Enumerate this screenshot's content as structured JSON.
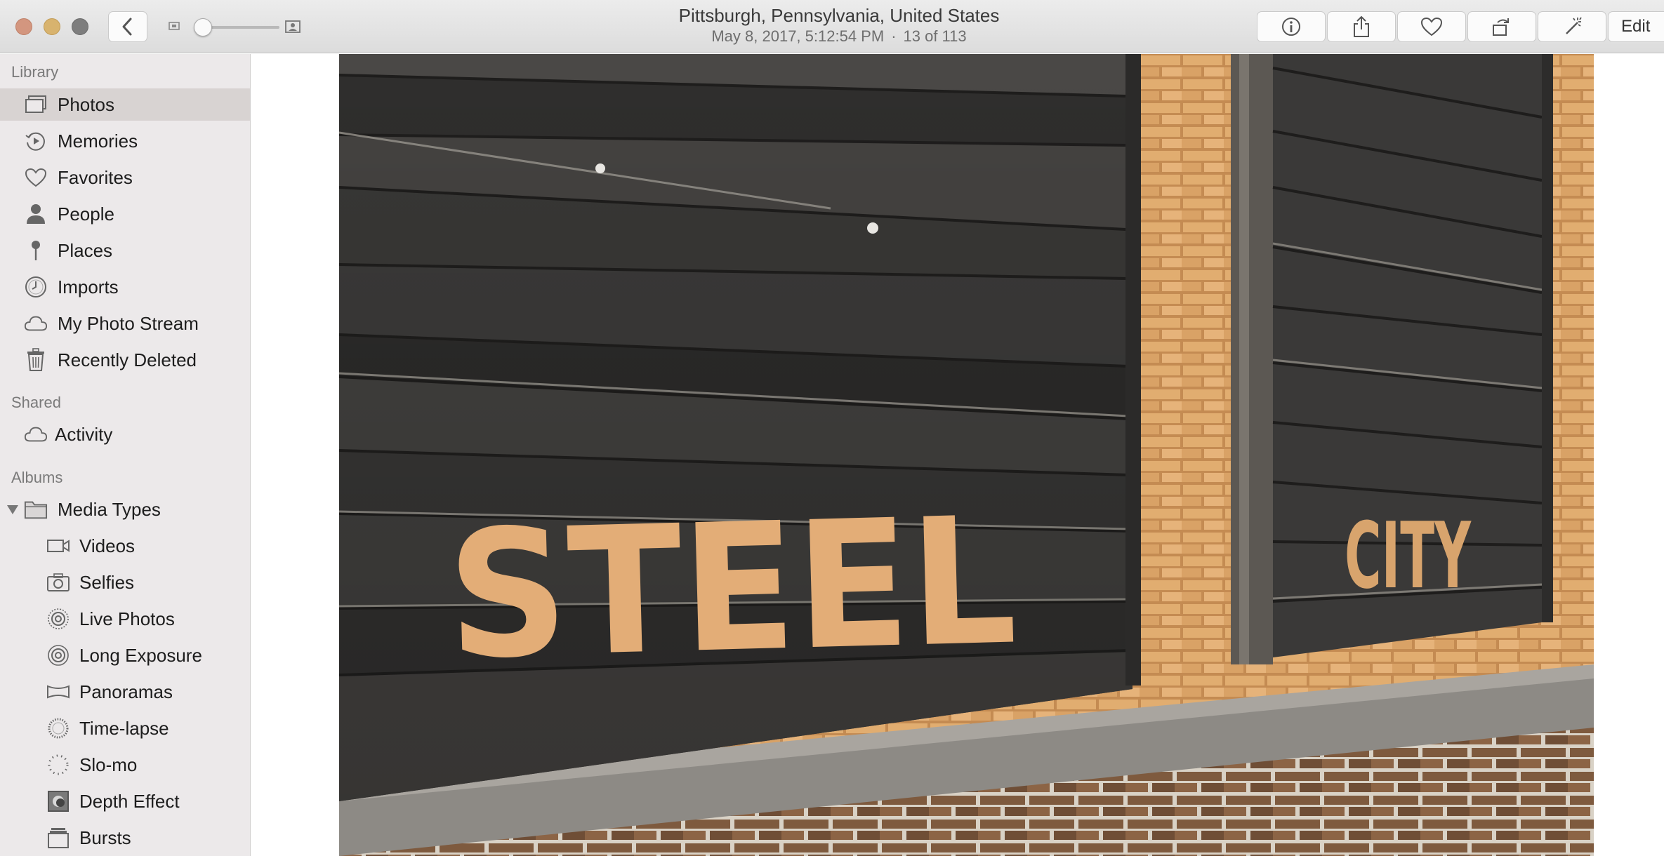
{
  "window": {
    "title": "Pittsburgh, Pennsylvania, United States",
    "date": "May 8, 2017, 5:12:54 PM",
    "separator": "·",
    "position": "13 of 113"
  },
  "toolbar": {
    "back_icon": "chevron-left-icon",
    "zoom_level": 0.05,
    "buttons": [
      {
        "icon": "info-icon"
      },
      {
        "icon": "share-icon"
      },
      {
        "icon": "heart-icon"
      },
      {
        "icon": "rotate-icon"
      },
      {
        "icon": "magic-wand-icon"
      }
    ],
    "edit_label": "Edit"
  },
  "sidebar": {
    "library_header": "Library",
    "library": [
      {
        "label": "Photos",
        "icon": "photos-icon",
        "selected": true
      },
      {
        "label": "Memories",
        "icon": "memories-icon"
      },
      {
        "label": "Favorites",
        "icon": "heart-icon"
      },
      {
        "label": "People",
        "icon": "person-icon"
      },
      {
        "label": "Places",
        "icon": "pin-icon"
      },
      {
        "label": "Imports",
        "icon": "clock-icon"
      },
      {
        "label": "My Photo Stream",
        "icon": "cloud-icon"
      },
      {
        "label": "Recently Deleted",
        "icon": "trash-icon"
      }
    ],
    "shared_header": "Shared",
    "shared": [
      {
        "label": "Activity",
        "icon": "cloud-icon"
      }
    ],
    "albums_header": "Albums",
    "albums": [
      {
        "label": "Media Types",
        "icon": "folder-icon",
        "expanded": true
      }
    ],
    "media_types": [
      {
        "label": "Videos",
        "icon": "video-icon"
      },
      {
        "label": "Selfies",
        "icon": "camera-icon"
      },
      {
        "label": "Live Photos",
        "icon": "live-photo-icon"
      },
      {
        "label": "Long Exposure",
        "icon": "long-exposure-icon"
      },
      {
        "label": "Panoramas",
        "icon": "panorama-icon"
      },
      {
        "label": "Time-lapse",
        "icon": "timelapse-icon"
      },
      {
        "label": "Slo-mo",
        "icon": "slomo-icon"
      },
      {
        "label": "Depth Effect",
        "icon": "depth-effect-icon"
      },
      {
        "label": "Bursts",
        "icon": "bursts-icon"
      }
    ]
  },
  "photo": {
    "sign_left": "STEEL",
    "sign_right": "CITY",
    "colors": {
      "wood": "#3b3a39",
      "brick": "#d9a66a",
      "paint": "#e7b27a"
    }
  }
}
